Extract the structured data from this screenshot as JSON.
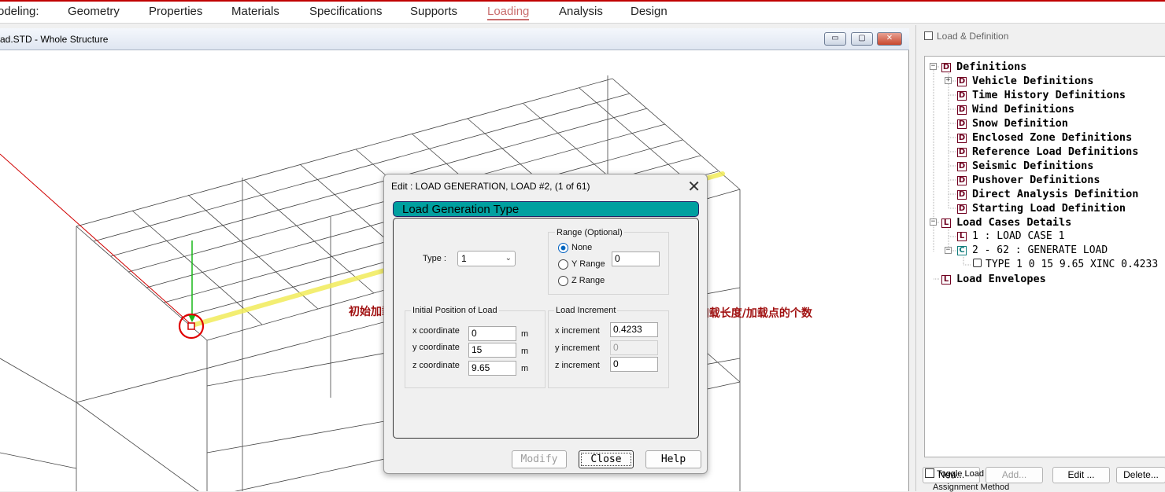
{
  "menubar": {
    "items": [
      "odeling:",
      "Geometry",
      "Properties",
      "Materials",
      "Specifications",
      "Supports",
      "Loading",
      "Analysis",
      "Design"
    ],
    "active": "Loading"
  },
  "view_window": {
    "title": "ad.STD - Whole Structure",
    "buttons": {
      "minimize": "▭",
      "restore": "▢",
      "close": "✕"
    }
  },
  "annotations": {
    "initial_point": "初始加载点",
    "increment_note": "加载位置增幅=加载长度/加载点的个数"
  },
  "dialog": {
    "title": "Edit : LOAD GENERATION, LOAD #2, (1 of 61)",
    "close_glyph": "✕",
    "section_header": "Load Generation Type",
    "type_label": "Type :",
    "type_value": "1",
    "range": {
      "title": "Range (Optional)",
      "options": [
        "None",
        "Y Range",
        "Z Range"
      ],
      "selected": "None",
      "y_value": "0"
    },
    "initial_position": {
      "title": "Initial Position of Load",
      "x_label": "x coordinate",
      "x_value": "0",
      "y_label": "y coordinate",
      "y_value": "15",
      "z_label": "z coordinate",
      "z_value": "9.65",
      "unit": "m"
    },
    "load_increment": {
      "title": "Load Increment",
      "x_label": "x increment",
      "x_value": "0.4233",
      "y_label": "y increment",
      "y_value": "0",
      "z_label": "z increment",
      "z_value": "0"
    },
    "buttons": {
      "modify": "Modify",
      "close": "Close",
      "help": "Help"
    }
  },
  "right_panel": {
    "title": "Load & Definition",
    "tree": {
      "definitions": "Definitions",
      "vehicle": "Vehicle Definitions",
      "time_history": "Time History Definitions",
      "wind": "Wind Definitions",
      "snow": "Snow Definition",
      "enclosed_zone": "Enclosed Zone Definitions",
      "reference_load": "Reference Load Definitions",
      "seismic": "Seismic Definitions",
      "pushover": "Pushover Definitions",
      "direct_analysis": "Direct Analysis Definition",
      "starting_load": "Starting Load Definition",
      "load_cases": "Load Cases Details",
      "case1": "1 : LOAD CASE 1",
      "case2": "2 - 62 : GENERATE LOAD",
      "type_cmd": "TYPE 1 0 15 9.65 XINC 0.4233",
      "envelopes": "Load Envelopes",
      "badge_d": "D",
      "badge_l": "L",
      "badge_c": "C",
      "expand_plus": "+",
      "expand_minus": "−"
    },
    "buttons": {
      "new": "New...",
      "add": "Add...",
      "edit": "Edit ...",
      "delete": "Delete..."
    },
    "toggle_load": "Toggle Load",
    "assignment_method": "Assignment Method"
  }
}
